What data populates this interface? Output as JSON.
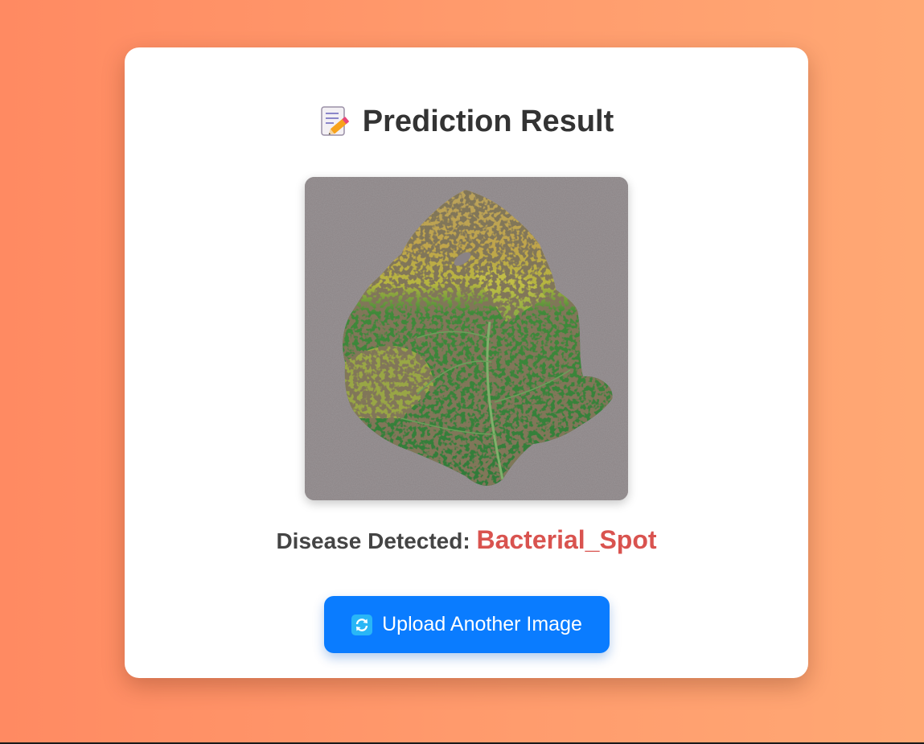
{
  "page": {
    "title": "Prediction Result",
    "title_icon": "memo-pencil-icon",
    "result_label": "Disease Detected:",
    "disease_name": "Bacterial_Spot",
    "upload_button_label": "Upload Another Image",
    "upload_button_icon": "refresh-arrows-icon",
    "leaf_image": "tomato-leaf-bacterial-spot-photo"
  },
  "colors": {
    "background_gradient_start": "#ff8a62",
    "background_gradient_end": "#ffa874",
    "card": "#ffffff",
    "title_text": "#333333",
    "label_text": "#444444",
    "disease_text": "#d9534f",
    "button": "#0a7cff",
    "button_text": "#ffffff"
  }
}
